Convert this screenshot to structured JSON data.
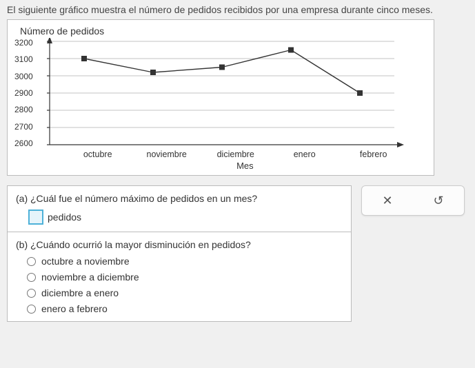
{
  "intro": "El siguiente gráfico muestra el número de pedidos recibidos por una empresa durante cinco meses.",
  "chart_data": {
    "type": "line",
    "title": "",
    "ylabel": "Número de pedidos",
    "xlabel": "Mes",
    "ylim": [
      2600,
      3200
    ],
    "yticks": [
      "3200",
      "3100",
      "3000",
      "2900",
      "2800",
      "2700",
      "2600"
    ],
    "categories": [
      "octubre",
      "noviembre",
      "diciembre",
      "enero",
      "febrero"
    ],
    "values": [
      3100,
      3020,
      3050,
      3150,
      2900
    ]
  },
  "q_a": {
    "label": "(a) ¿Cuál fue el número máximo de pedidos en un mes?",
    "unit": "pedidos"
  },
  "q_b": {
    "label": "(b) ¿Cuándo ocurrió la mayor disminución en pedidos?",
    "options": [
      "octubre a noviembre",
      "noviembre a diciembre",
      "diciembre a enero",
      "enero a febrero"
    ]
  },
  "tools": {
    "close": "✕",
    "reset": "↺"
  }
}
